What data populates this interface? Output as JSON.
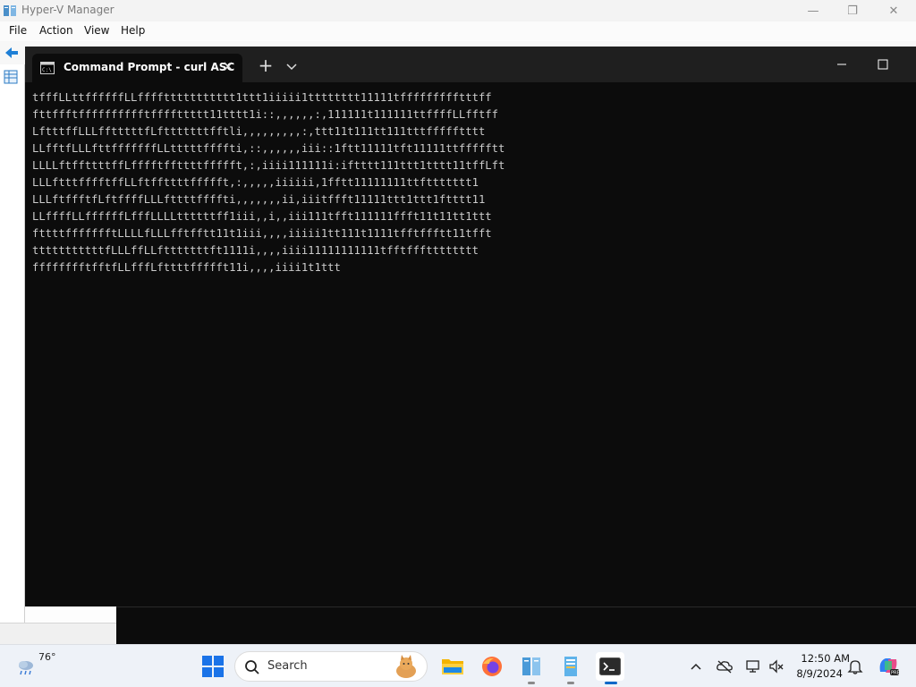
{
  "hyperv": {
    "title": "Hyper-V Manager",
    "menu": [
      "File",
      "Action",
      "View",
      "Help"
    ],
    "controls": {
      "minimize": "—",
      "restore": "❐",
      "close": "✕"
    }
  },
  "terminal": {
    "tab_title": "Command Prompt - curl  ASC",
    "close_glyph": "✕",
    "new_tab_glyph": "+",
    "output": [
      "tfffLLttffffffLLffffttttttttttt1ttt1iiiii1tttttttt11111tffffffffftttff",
      "fttffftfffffffffftffffttttt11tttt1i::,,,,,,:,111111t111111ttffffLLfftff",
      "LftttffLLLfftttttfLftttttttfftli,,,,,,,,,:,ttt11t111tt111tttffffftttt",
      "LLfftfLLLfttfffffffLLtttttffffti,::,,,,,,iii::1ftt11111tft11111ttffffftt",
      "LLLLftffttttffLfffftffttttffffft,:,iiii111111i:iftttt111ttt1tttt11tffLft",
      "LLLftttfffftffLLftffttttffffft,:,,,,,iiiiii,1fftt11111111ttfttttttt1",
      "LLLftffftfLftffffLLLfttttffffti,,,,,,,ii,iiitffft11111ttt1ttt1ftttt11",
      "LLffffLLffffffLfffLLLLttttttff1iii,,i,,iii111tfft111111ffft11t11tt1ttt",
      "fttttffffffftLLLLfLLLfftfftt11t1iii,,,,iiiii1tt111t1111tfftffftt11tfft",
      "tttttttttttfLLLffLLftttttttft1111i,,,,iiii11111111111tfftffftttttttt",
      "fffffffftfftfLLfffLfttttffffft11i,,,,iiii1t1ttt"
    ]
  },
  "taskbar": {
    "weather_temp": "76°",
    "search_label": "Search",
    "clock_time": "12:50 AM",
    "clock_date": "8/9/2024"
  },
  "colors": {
    "terminal_bg": "#0c0c0c",
    "terminal_text": "#cccccc",
    "accent": "#0a67c7",
    "taskbar_bg": "#eef2f8"
  }
}
